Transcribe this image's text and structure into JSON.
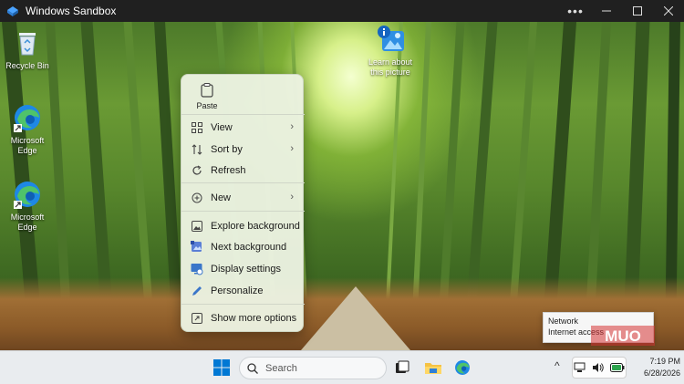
{
  "window": {
    "title": "Windows Sandbox",
    "controls": [
      "more-icon",
      "minimize-icon",
      "maximize-icon",
      "close-icon"
    ]
  },
  "desktop": {
    "icons": [
      {
        "label": "Recycle Bin",
        "icon": "recycle-bin-icon"
      },
      {
        "label": "Microsoft Edge",
        "icon": "edge-icon"
      },
      {
        "label": "Microsoft Edge",
        "icon": "edge-icon"
      },
      {
        "label": "Learn about this picture",
        "icon": "learn-picture-icon"
      }
    ]
  },
  "context_menu": {
    "paste_label": "Paste",
    "items": [
      {
        "label": "View",
        "icon": "grid-icon",
        "submenu": true
      },
      {
        "label": "Sort by",
        "icon": "sort-icon",
        "submenu": true
      },
      {
        "label": "Refresh",
        "icon": "refresh-icon",
        "submenu": false
      },
      {
        "label": "New",
        "icon": "plus-circle-icon",
        "submenu": true
      },
      {
        "label": "Explore background",
        "icon": "image-icon",
        "submenu": false
      },
      {
        "label": "Next background",
        "icon": "next-image-icon",
        "submenu": false
      },
      {
        "label": "Display settings",
        "icon": "display-icon",
        "submenu": false
      },
      {
        "label": "Personalize",
        "icon": "pen-icon",
        "submenu": false
      },
      {
        "label": "Show more options",
        "icon": "more-options-icon",
        "submenu": false
      }
    ],
    "chevron": "›"
  },
  "tooltip": {
    "line1": "Network",
    "line2": "Internet access"
  },
  "watermark": "MUO",
  "taskbar": {
    "search_placeholder": "Search",
    "clock_time": "7:19 PM",
    "clock_date": "6/28/2026",
    "overflow_chevron": "^",
    "colors": {
      "start_blue": "#0078d4",
      "edge_blue": "#1e88e5",
      "folder_yellow": "#f5c243"
    }
  }
}
